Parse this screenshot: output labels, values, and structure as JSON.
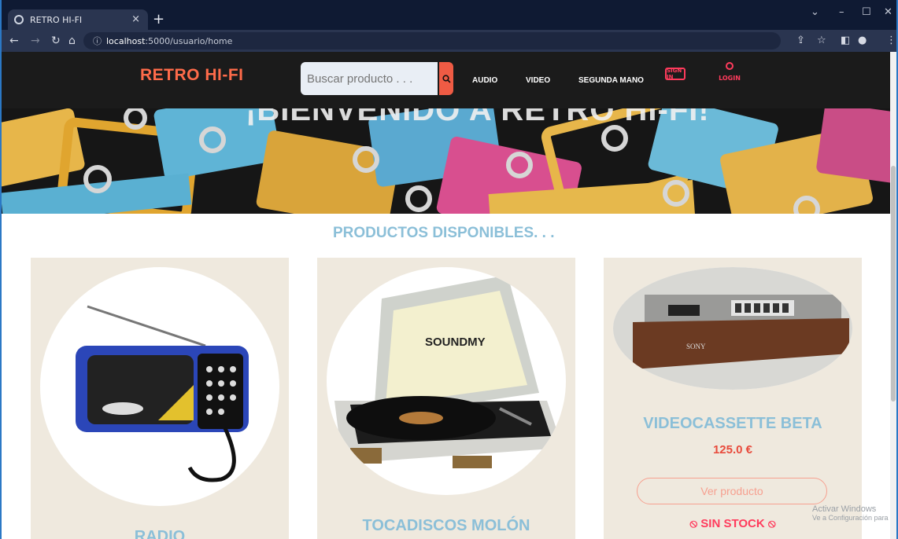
{
  "browser": {
    "tab_title": "RETRO HI-FI",
    "url_host": "localhost",
    "url_rest": ":5000/usuario/home",
    "close_glyph": "×",
    "newtab_glyph": "+"
  },
  "header": {
    "brand": "RETRO HI-FI",
    "search_placeholder": "Buscar producto . . .",
    "nav": [
      "AUDIO",
      "VIDEO",
      "SEGUNDA MANO"
    ],
    "signin": "SIGN IN",
    "login": "LOGIN"
  },
  "banner": {
    "title": "¡BIENVENIDO A RETRO HI-FI!"
  },
  "main": {
    "section_title": "PRODUCTOS DISPONIBLES. . .",
    "products": [
      {
        "name": "RADIO",
        "image_icon": "radio-image"
      },
      {
        "name": "TOCADISCOS MOLÓN",
        "image_icon": "turntable-image",
        "brand_on_image": "SOUNDMY"
      },
      {
        "name": "VIDEOCASSETTE BETA",
        "price": "125.0 €",
        "button": "Ver producto",
        "stock": "SIN STOCK",
        "image_icon": "vcr-image"
      }
    ]
  },
  "os": {
    "watermark_title": "Activar Windows",
    "watermark_sub": "Ve a Configuración para"
  },
  "colors": {
    "brand": "#ff6b4a",
    "accent_blue": "#8bbfd8",
    "price": "#e84b3c",
    "alert": "#ff3b5c"
  }
}
